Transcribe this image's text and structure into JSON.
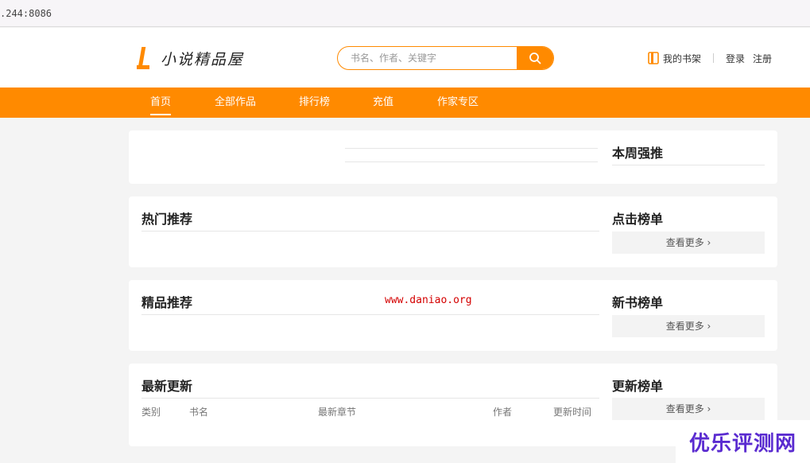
{
  "browser": {
    "address": ".244:8086"
  },
  "header": {
    "logo_text": "小说精品屋",
    "search_placeholder": "书名、作者、关键字",
    "shelf_label": "我的书架",
    "login_label": "登录",
    "register_label": "注册"
  },
  "nav": {
    "items": [
      {
        "label": "首页",
        "active": true
      },
      {
        "label": "全部作品"
      },
      {
        "label": "排行榜"
      },
      {
        "label": "充值"
      },
      {
        "label": "作家专区"
      }
    ]
  },
  "sections": {
    "weekly": {
      "title": "本周强推"
    },
    "hot": {
      "title": "热门推荐",
      "rank_title": "点击榜单",
      "more": "查看更多 ›"
    },
    "featured": {
      "title": "精品推荐",
      "rank_title": "新书榜单",
      "more": "查看更多 ›"
    },
    "latest": {
      "title": "最新更新",
      "rank_title": "更新榜单",
      "more": "查看更多 ›",
      "columns": [
        "类别",
        "书名",
        "最新章节",
        "作者",
        "更新时间"
      ]
    }
  },
  "overlays": {
    "watermark_url": "www.daniao.org",
    "corner_logo": "优乐评测网"
  },
  "colors": {
    "accent": "#ff8a00",
    "watermark": "#d40000",
    "corner_logo": "#5a2bd0"
  }
}
